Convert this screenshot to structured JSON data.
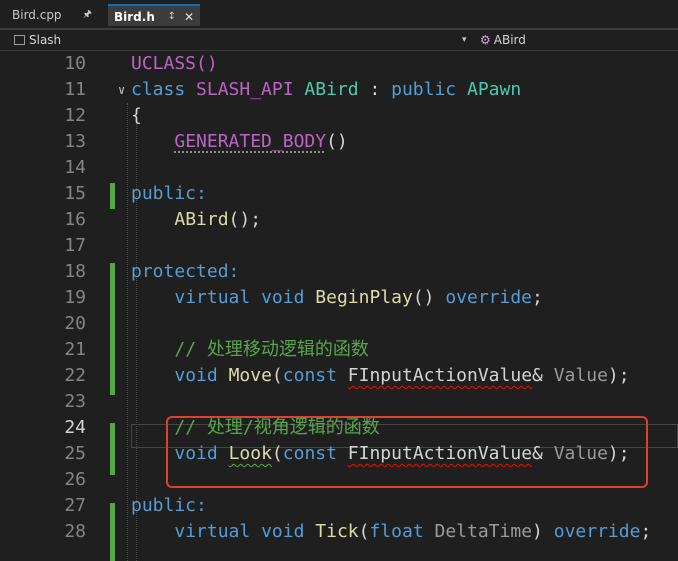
{
  "tabs": [
    {
      "label": "Bird.cpp",
      "active": false
    },
    {
      "label": "Bird.h",
      "active": true
    }
  ],
  "tab_icons": {
    "pin": "pin-icon",
    "close": "close-icon"
  },
  "nav": {
    "project": "Slash",
    "symbol": "ABird",
    "project_icon": "project-icon",
    "symbol_icon": "class-icon"
  },
  "editor": {
    "current_line": 24,
    "lines": [
      {
        "num": "10",
        "code": "UCLASS()"
      },
      {
        "num": "11",
        "code": "class SLASH_API ABird : public APawn"
      },
      {
        "num": "12",
        "code": "{"
      },
      {
        "num": "13",
        "code": "GENERATED_BODY()"
      },
      {
        "num": "14",
        "code": ""
      },
      {
        "num": "15",
        "code": "public:"
      },
      {
        "num": "16",
        "code": "ABird();"
      },
      {
        "num": "17",
        "code": ""
      },
      {
        "num": "18",
        "code": "protected:"
      },
      {
        "num": "19",
        "code": "virtual void BeginPlay() override;"
      },
      {
        "num": "20",
        "code": ""
      },
      {
        "num": "21",
        "code": "// 处理移动逻辑的函数"
      },
      {
        "num": "22",
        "code": "void Move(const FInputActionValue& Value);"
      },
      {
        "num": "23",
        "code": ""
      },
      {
        "num": "24",
        "code": "// 处理/视角逻辑的函数"
      },
      {
        "num": "25",
        "code": "void Look(const FInputActionValue& Value);"
      },
      {
        "num": "26",
        "code": ""
      },
      {
        "num": "27",
        "code": "public:"
      },
      {
        "num": "28",
        "code": "virtual void Tick(float DeltaTime) override;"
      }
    ]
  },
  "colors": {
    "background": "#1f1f1f",
    "keyword": "#569cd6",
    "type": "#4ec9b0",
    "macro": "#bd63c5",
    "function": "#dcdcaa",
    "comment": "#57a64a",
    "change_marker": "#57a64a",
    "highlight_box": "#e0412b"
  }
}
